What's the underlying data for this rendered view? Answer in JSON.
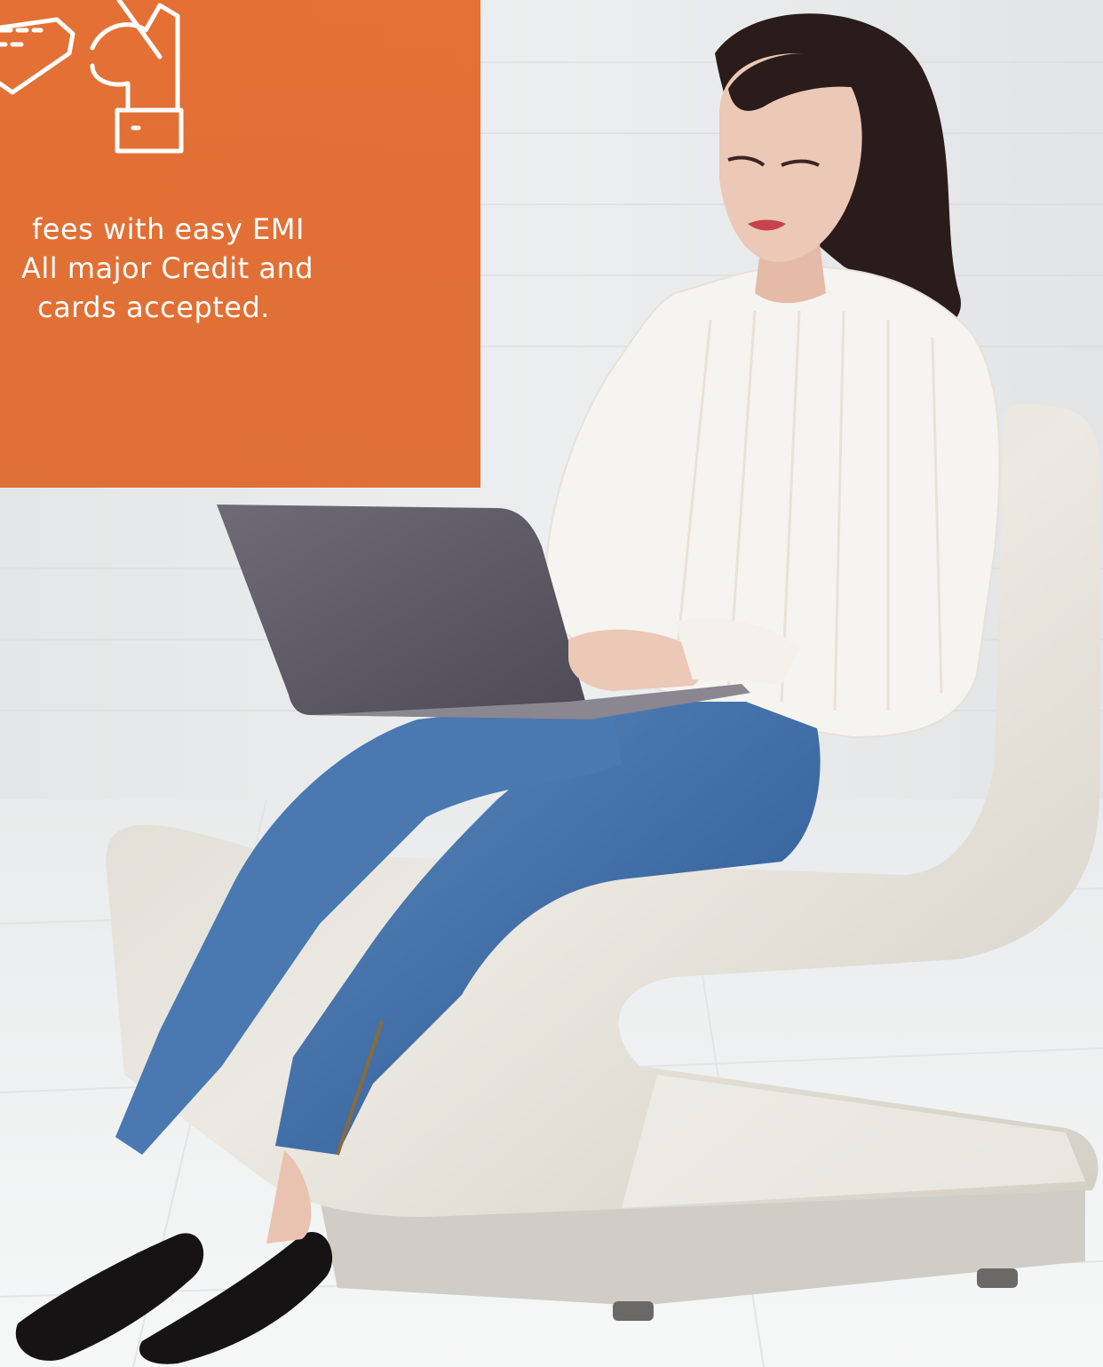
{
  "promo": {
    "lines": [
      "fees with easy EMI",
      "All major Credit and",
      "cards accepted."
    ],
    "panel_color": "#E0682A",
    "icon": "card-payment-hand-icon"
  },
  "scene": {
    "colors": {
      "wall": "#ECEEEF",
      "floor": "#F2F3F4",
      "chair": "#E6E3DB",
      "sweater": "#F6F4F0",
      "jeans": "#3F6FA8",
      "laptop": "#5E5B66",
      "hair": "#2A1C1A",
      "skin": "#E9C3B0",
      "shoes": "#151313"
    }
  }
}
